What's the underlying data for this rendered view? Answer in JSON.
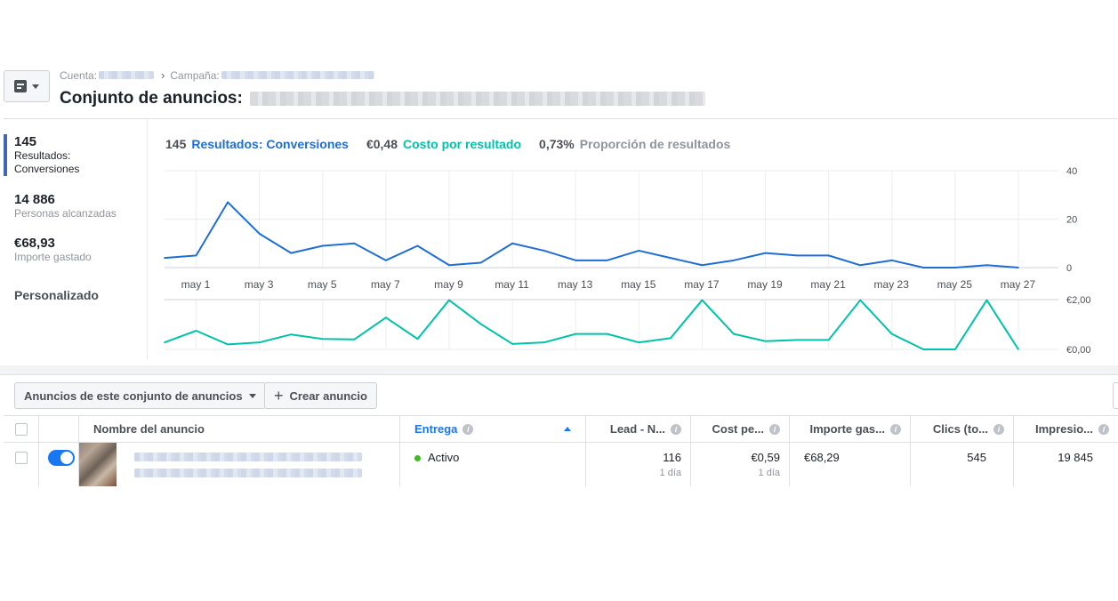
{
  "header": {
    "account_label": "Cuenta:",
    "campaign_label": "Campaña:",
    "title_prefix": "Conjunto de anuncios:"
  },
  "metrics": [
    {
      "value": "145",
      "label_1": "Resultados:",
      "label_2": "Conversiones",
      "selected": true
    },
    {
      "value": "14 886",
      "label_1": "Personas alcanzadas"
    },
    {
      "value": "€68,93",
      "label_1": "Importe gastado"
    }
  ],
  "custom_label": "Personalizado",
  "legend": {
    "results_value": "145",
    "results_label": "Resultados: Conversiones",
    "cost_value": "€0,48",
    "cost_label": "Costo por resultado",
    "rate_value": "0,73%",
    "rate_label": "Proporción de resultados"
  },
  "colors": {
    "results": "#1f6ed4",
    "cost": "#00c2a8",
    "active": "#42b72a",
    "accent": "#4267b2"
  },
  "chart_data": [
    {
      "type": "line",
      "series": [
        {
          "name": "Resultados: Conversiones",
          "values": [
            4,
            5,
            27,
            14,
            6,
            9,
            10,
            3,
            9,
            1,
            2,
            10,
            7,
            3,
            3,
            7,
            4,
            1,
            3,
            6,
            5,
            5,
            1,
            3,
            0,
            0,
            1,
            0
          ]
        }
      ],
      "x_tick_labels": [
        "may 1",
        "may 3",
        "may 5",
        "may 7",
        "may 9",
        "may 11",
        "may 13",
        "may 15",
        "may 17",
        "may 19",
        "may 21",
        "may 23",
        "may 25",
        "may 27"
      ],
      "y_tick_labels": [
        "40",
        "20",
        "0"
      ],
      "ylim": [
        0,
        40
      ],
      "grid": true
    },
    {
      "type": "line",
      "series": [
        {
          "name": "Costo por resultado",
          "values": [
            0.28,
            0.75,
            0.2,
            0.28,
            0.6,
            0.42,
            0.4,
            1.28,
            0.42,
            1.98,
            1.02,
            0.22,
            0.28,
            0.62,
            0.62,
            0.28,
            0.45,
            1.98,
            0.62,
            0.33,
            0.38,
            0.38,
            1.98,
            0.62,
            0,
            0,
            1.98,
            0
          ]
        }
      ],
      "y_tick_labels": [
        "€2,00",
        "€0,00"
      ],
      "ylim": [
        0,
        2
      ],
      "grid": true
    }
  ],
  "toolbar": {
    "ads_dropdown": "Anuncios de este conjunto de anuncios",
    "create_ad": "Crear anuncio"
  },
  "table": {
    "headers": {
      "name": "Nombre del anuncio",
      "delivery": "Entrega",
      "leads": "Lead - N...",
      "cost": "Cost pe...",
      "spend": "Importe gas...",
      "clicks": "Clics (to...",
      "impressions": "Impresio..."
    },
    "rows": [
      {
        "delivery": "Activo",
        "leads": "116",
        "leads_sub": "1 día",
        "cost": "€0,59",
        "cost_sub": "1 día",
        "spend": "€68,29",
        "clicks": "545",
        "impressions": "19 845"
      }
    ]
  }
}
